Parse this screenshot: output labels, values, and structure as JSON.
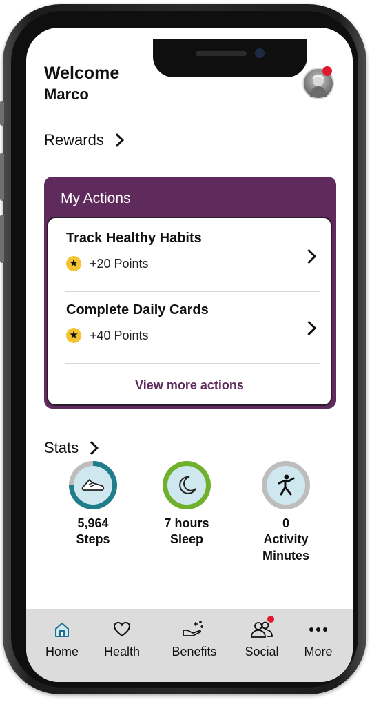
{
  "header": {
    "welcome": "Welcome",
    "username": "Marco"
  },
  "rewards": {
    "label": "Rewards"
  },
  "actions": {
    "title": "My Actions",
    "items": [
      {
        "title": "Track Healthy Habits",
        "points": "+20 Points"
      },
      {
        "title": "Complete Daily Cards",
        "points": "+40 Points"
      }
    ],
    "view_more": "View more actions"
  },
  "stats": {
    "label": "Stats",
    "items": [
      {
        "value": "5,964",
        "label": "Steps",
        "icon": "shoe-icon",
        "ring_color": "#1f7d8c",
        "progress_fraction": 0.75
      },
      {
        "value": "7 hours",
        "label": "Sleep",
        "icon": "moon-icon",
        "ring_color": "#6fb12d",
        "progress_fraction": 1.0
      },
      {
        "value": "0",
        "label": "Activity\nMinutes",
        "icon": "running-person-icon",
        "ring_color": "#bdbdbd",
        "progress_fraction": 0.0
      }
    ]
  },
  "nav": {
    "items": [
      {
        "label": "Home",
        "icon": "home-icon"
      },
      {
        "label": "Health",
        "icon": "heart-icon"
      },
      {
        "label": "Benefits",
        "icon": "hand-sparkle-icon"
      },
      {
        "label": "Social",
        "icon": "people-icon"
      },
      {
        "label": "More",
        "icon": "more-dots-icon"
      }
    ]
  },
  "colors": {
    "brand_purple": "#5f2a5c",
    "star_yellow": "#f4c430",
    "notification_red": "#e0192f",
    "nav_bg": "#dcdcdc"
  }
}
